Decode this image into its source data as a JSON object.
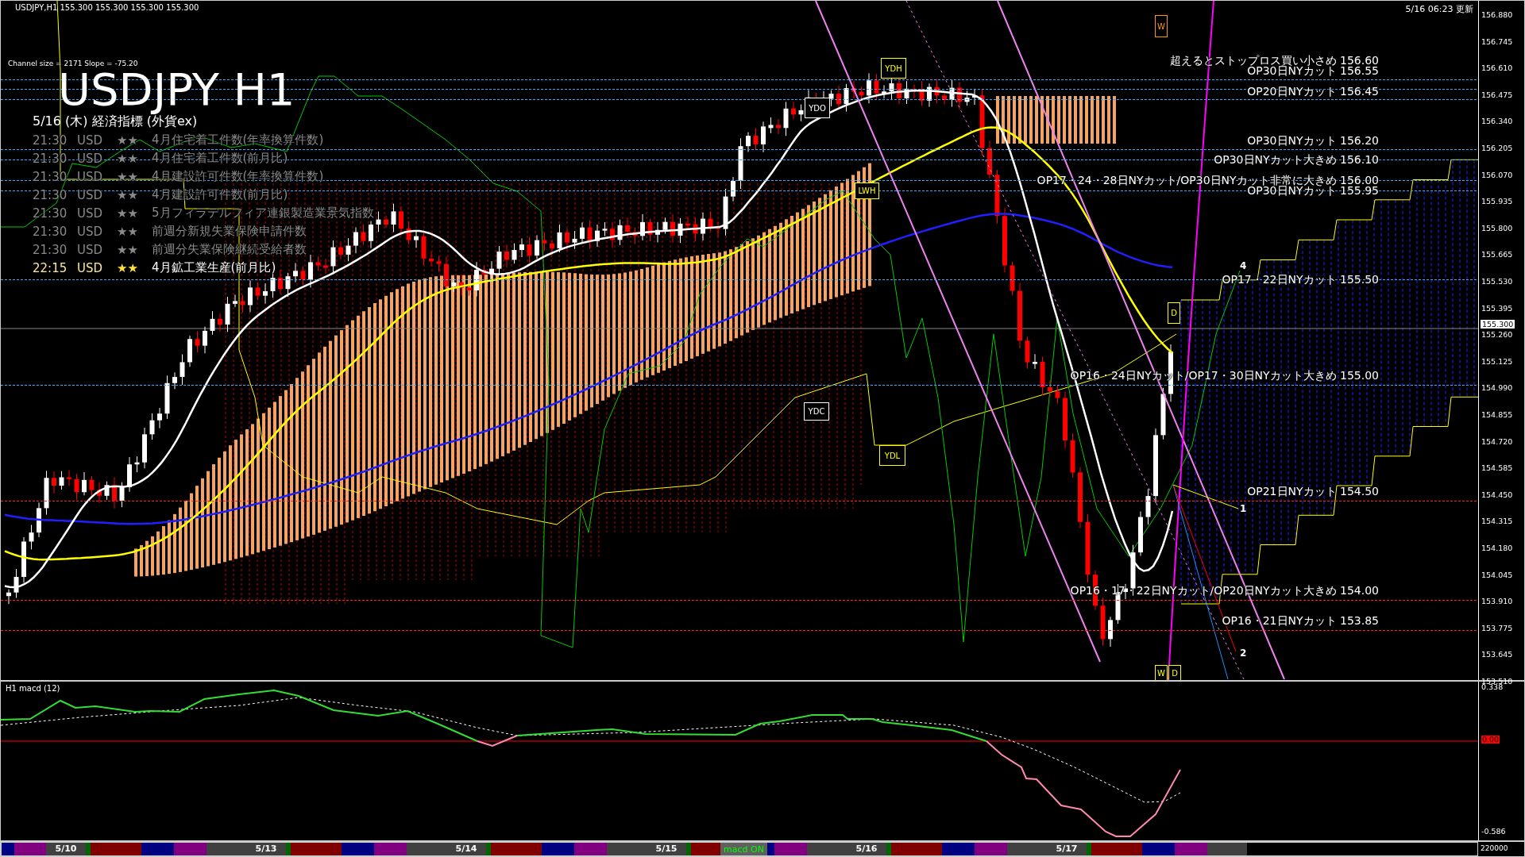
{
  "header": {
    "symbol_line": "USDJPY,H1  155.300 155.300 155.300 155.300",
    "channel_info": "Channel size = 2171 Slope = -75.20",
    "title": "USDJPY H1",
    "updated": "5/16 06:23 更新"
  },
  "calendar": {
    "title": "5/16 (木) 経済指標 (外貨ex)",
    "events": [
      {
        "time": "21:30",
        "currency": "USD",
        "importance": "★★",
        "name": "4月住宅着工件数(年率換算件数)",
        "highlighted": false
      },
      {
        "time": "21:30",
        "currency": "USD",
        "importance": "★★",
        "name": "4月住宅着工件数(前月比)",
        "highlighted": false
      },
      {
        "time": "21:30",
        "currency": "USD",
        "importance": "★★",
        "name": "4月建設許可件数(年率換算件数)",
        "highlighted": false
      },
      {
        "time": "21:30",
        "currency": "USD",
        "importance": "★★",
        "name": "4月建設許可件数(前月比)",
        "highlighted": false
      },
      {
        "time": "21:30",
        "currency": "USD",
        "importance": "★★",
        "name": "5月フィラデルフィア連銀製造業景気指数",
        "highlighted": false
      },
      {
        "time": "21:30",
        "currency": "USD",
        "importance": "★★",
        "name": "前週分新規失業保険申請件数",
        "highlighted": false
      },
      {
        "time": "21:30",
        "currency": "USD",
        "importance": "★★",
        "name": "前週分失業保険継続受給者数",
        "highlighted": false
      },
      {
        "time": "22:15",
        "currency": "USD",
        "importance": "★★",
        "name": "4月鉱工業生産(前月比)",
        "highlighted": true
      }
    ]
  },
  "levels": [
    {
      "label": "超えるとストップロス買い小さめ 156.60",
      "color": "#3fa9ff"
    },
    {
      "label": "OP30日NYカット 156.55",
      "color": "#3fa9ff"
    },
    {
      "label": "OP20日NYカット 156.45",
      "color": "#3fa9ff"
    },
    {
      "label": "OP30日NYカット 156.20",
      "color": "#3fa9ff"
    },
    {
      "label": "OP30日NYカット大きめ 156.10",
      "color": "#3fa9ff"
    },
    {
      "label": "OP17・24・28日NYカット/OP30日NYカット非常に大きめ 156.00",
      "color": "#3fa9ff"
    },
    {
      "label": "OP30日NYカット 155.95",
      "color": "#3fa9ff"
    },
    {
      "label": "OP17・22日NYカット 155.50",
      "color": "#3fa9ff"
    },
    {
      "label": "OP16・24日NYカット/OP17・30日NYカット大きめ 155.00",
      "color": "#3fa9ff"
    },
    {
      "label": "OP21日NYカット 154.50",
      "color": "#ff2020"
    },
    {
      "label": "OP16・17・22日NYカット/OP20日NYカット大きめ 154.00",
      "color": "#ff2020"
    },
    {
      "label": "OP16・21日NYカット 153.85",
      "color": "#ff2020"
    }
  ],
  "markers": [
    {
      "label": "YDH",
      "color": "#ffff00"
    },
    {
      "label": "YDO",
      "color": "#ffffff"
    },
    {
      "label": "LWH",
      "color": "#ffff00"
    },
    {
      "label": "YDC",
      "color": "#ffffff"
    },
    {
      "label": "YDL",
      "color": "#ffff00"
    },
    {
      "label": "W",
      "color": "#ff9900"
    },
    {
      "label": "D",
      "color": "#ffff00"
    },
    {
      "label": "W",
      "color": "#ffff00"
    },
    {
      "label": "D",
      "color": "#ffff00"
    }
  ],
  "wave_labels": [
    "4",
    "1",
    "2"
  ],
  "price_axis": {
    "ticks": [
      "156.880",
      "156.745",
      "156.610",
      "156.475",
      "156.340",
      "156.205",
      "156.070",
      "155.935",
      "155.800",
      "155.665",
      "155.530",
      "155.395",
      "155.260",
      "155.125",
      "154.990",
      "154.855",
      "154.720",
      "154.585",
      "154.450",
      "154.315",
      "154.180",
      "154.045",
      "153.910",
      "153.775",
      "153.645",
      "153.510"
    ],
    "current": "155.300"
  },
  "macd": {
    "title": "H1  macd (12)",
    "axis": [
      "0.338",
      "0.00",
      "-0.586"
    ],
    "volume_label": "220000"
  },
  "date_strip": {
    "dates": [
      "5/10",
      "5/13",
      "5/14",
      "5/15",
      "5/16",
      "5/17"
    ],
    "toggle": "macd ON"
  }
}
